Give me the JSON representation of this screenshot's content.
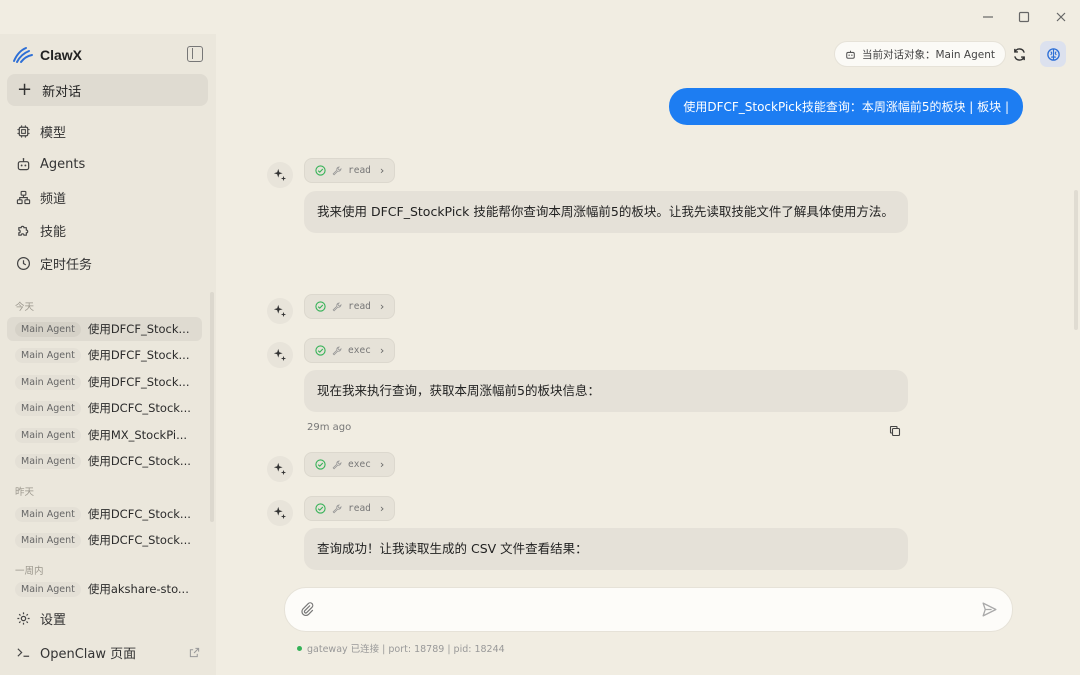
{
  "window": {
    "minimize": "—",
    "maximize": "☐",
    "close": "✕"
  },
  "sidebar": {
    "brand": "ClawX",
    "new_chat": "新对话",
    "nav": [
      {
        "label": "模型",
        "icon": "chip-icon"
      },
      {
        "label": "Agents",
        "icon": "robot-icon"
      },
      {
        "label": "频道",
        "icon": "network-icon"
      },
      {
        "label": "技能",
        "icon": "puzzle-icon"
      },
      {
        "label": "定时任务",
        "icon": "clock-icon"
      }
    ],
    "sections": {
      "today": "今天",
      "yesterday": "昨天",
      "week": "一周内"
    },
    "history": [
      {
        "agent": "Main Agent",
        "title": "使用DFCF_Stock..."
      },
      {
        "agent": "Main Agent",
        "title": "使用DFCF_Stock..."
      },
      {
        "agent": "Main Agent",
        "title": "使用DFCF_Stock..."
      },
      {
        "agent": "Main Agent",
        "title": "使用DCFC_Stock..."
      },
      {
        "agent": "Main Agent",
        "title": "使用MX_StockPi..."
      },
      {
        "agent": "Main Agent",
        "title": "使用DCFC_Stock..."
      },
      {
        "agent": "Main Agent",
        "title": "使用DCFC_Stock..."
      },
      {
        "agent": "Main Agent",
        "title": "使用DCFC_Stock..."
      },
      {
        "agent": "Main Agent",
        "title": "使用akshare-sto..."
      }
    ],
    "settings": "设置",
    "openclaw": "OpenClaw 页面"
  },
  "header": {
    "agent_target": "当前对话对象：Main Agent"
  },
  "chat": {
    "user_message": "使用DFCF_StockPick技能查询：本周涨幅前5的板块 | 板块 |",
    "tools": [
      "read",
      "read",
      "exec",
      "exec",
      "read"
    ],
    "messages": [
      "我来使用 DFCF_StockPick 技能帮你查询本周涨幅前5的板块。让我先读取技能文件了解具体使用方法。",
      "现在我来执行查询，获取本周涨幅前5的板块信息：",
      "查询成功！让我读取生成的 CSV 文件查看结果："
    ],
    "time": "29m ago"
  },
  "input": {
    "placeholder": ""
  },
  "status": {
    "text": "gateway 已连接 | port: 18789 | pid: 18244"
  },
  "colors": {
    "accent": "#1d7df2",
    "success": "#35b257",
    "background": "#f1ede2"
  }
}
